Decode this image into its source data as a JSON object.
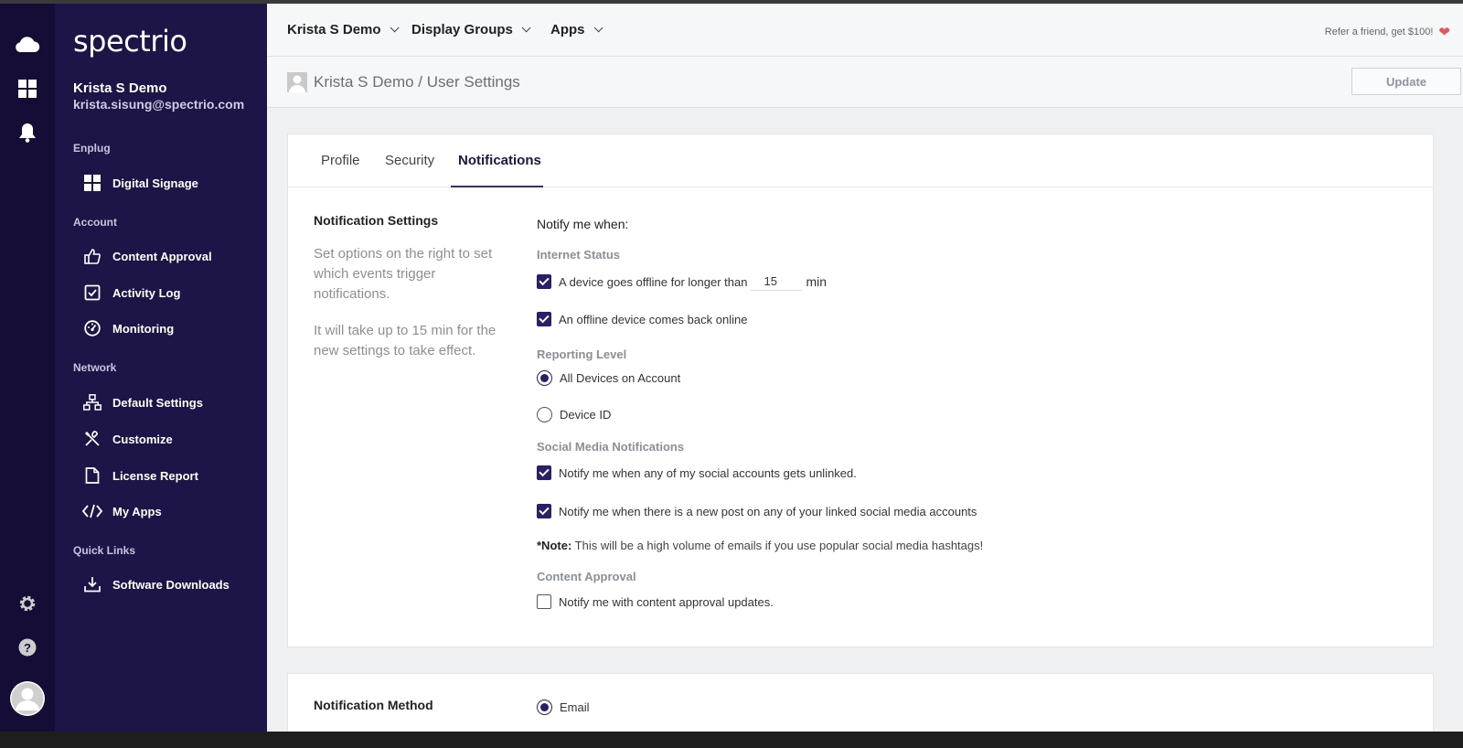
{
  "brand": {
    "name": "spectrio"
  },
  "user": {
    "name": "Krista S Demo",
    "email": "krista.sisung@spectrio.com"
  },
  "sidebar": {
    "sections": [
      {
        "label": "Enplug"
      },
      {
        "label": "Account"
      },
      {
        "label": "Network"
      },
      {
        "label": "Quick Links"
      }
    ],
    "items": [
      {
        "label": "Digital Signage",
        "icon": "grid-icon"
      },
      {
        "label": "Content Approval",
        "icon": "thumbs-up-icon"
      },
      {
        "label": "Activity Log",
        "icon": "checkbox-icon"
      },
      {
        "label": "Monitoring",
        "icon": "gauge-icon"
      },
      {
        "label": "Default Settings",
        "icon": "sitemap-icon"
      },
      {
        "label": "Customize",
        "icon": "tools-icon"
      },
      {
        "label": "License Report",
        "icon": "document-icon"
      },
      {
        "label": "My Apps",
        "icon": "code-icon"
      },
      {
        "label": "Software Downloads",
        "icon": "download-icon"
      }
    ]
  },
  "rail": {
    "icons": [
      "cloud-icon",
      "dashboard-icon",
      "bell-icon",
      "gear-icon",
      "help-icon",
      "avatar-icon"
    ]
  },
  "topnav": {
    "items": [
      {
        "label": "Krista S Demo"
      },
      {
        "label": "Display Groups"
      },
      {
        "label": "Apps"
      }
    ],
    "refer": "Refer a friend, get $100!"
  },
  "breadcrumb": {
    "text": "Krista S Demo / User Settings"
  },
  "actions": {
    "update_label": "Update"
  },
  "tabs": [
    {
      "label": "Profile",
      "active": false
    },
    {
      "label": "Security",
      "active": false
    },
    {
      "label": "Notifications",
      "active": true
    }
  ],
  "notification_settings": {
    "title": "Notification Settings",
    "desc1": "Set options on the right to set which events trigger notifications.",
    "desc2": "It will take up to 15 min for the new settings to take effect.",
    "notify_heading": "Notify me when:",
    "internet_status": {
      "label": "Internet Status",
      "offline_label": "A device goes offline for longer than",
      "offline_checked": true,
      "offline_minutes": "15",
      "unit": "min",
      "back_online_label": "An offline device comes back online",
      "back_online_checked": true
    },
    "reporting_level": {
      "label": "Reporting Level",
      "options": [
        {
          "label": "All Devices on Account",
          "selected": true
        },
        {
          "label": "Device ID",
          "selected": false
        }
      ]
    },
    "social_media": {
      "label": "Social Media Notifications",
      "unlinked_label": "Notify me when any of my social accounts gets unlinked.",
      "unlinked_checked": true,
      "new_post_label": "Notify me when there is a new post on any of your linked social media accounts",
      "new_post_checked": true,
      "note_prefix": "*Note:",
      "note_text": "This will be a high volume of emails if you use popular social media hashtags!"
    },
    "content_approval": {
      "label": "Content Approval",
      "updates_label": "Notify me with content approval updates.",
      "updates_checked": false
    }
  },
  "notification_method": {
    "title": "Notification Method",
    "options": [
      {
        "label": "Email",
        "selected": true
      }
    ]
  },
  "colors": {
    "sidebar": "#1d1447",
    "rail": "#150d35",
    "accent": "#2d1e6b",
    "heart": "#e8525c"
  }
}
